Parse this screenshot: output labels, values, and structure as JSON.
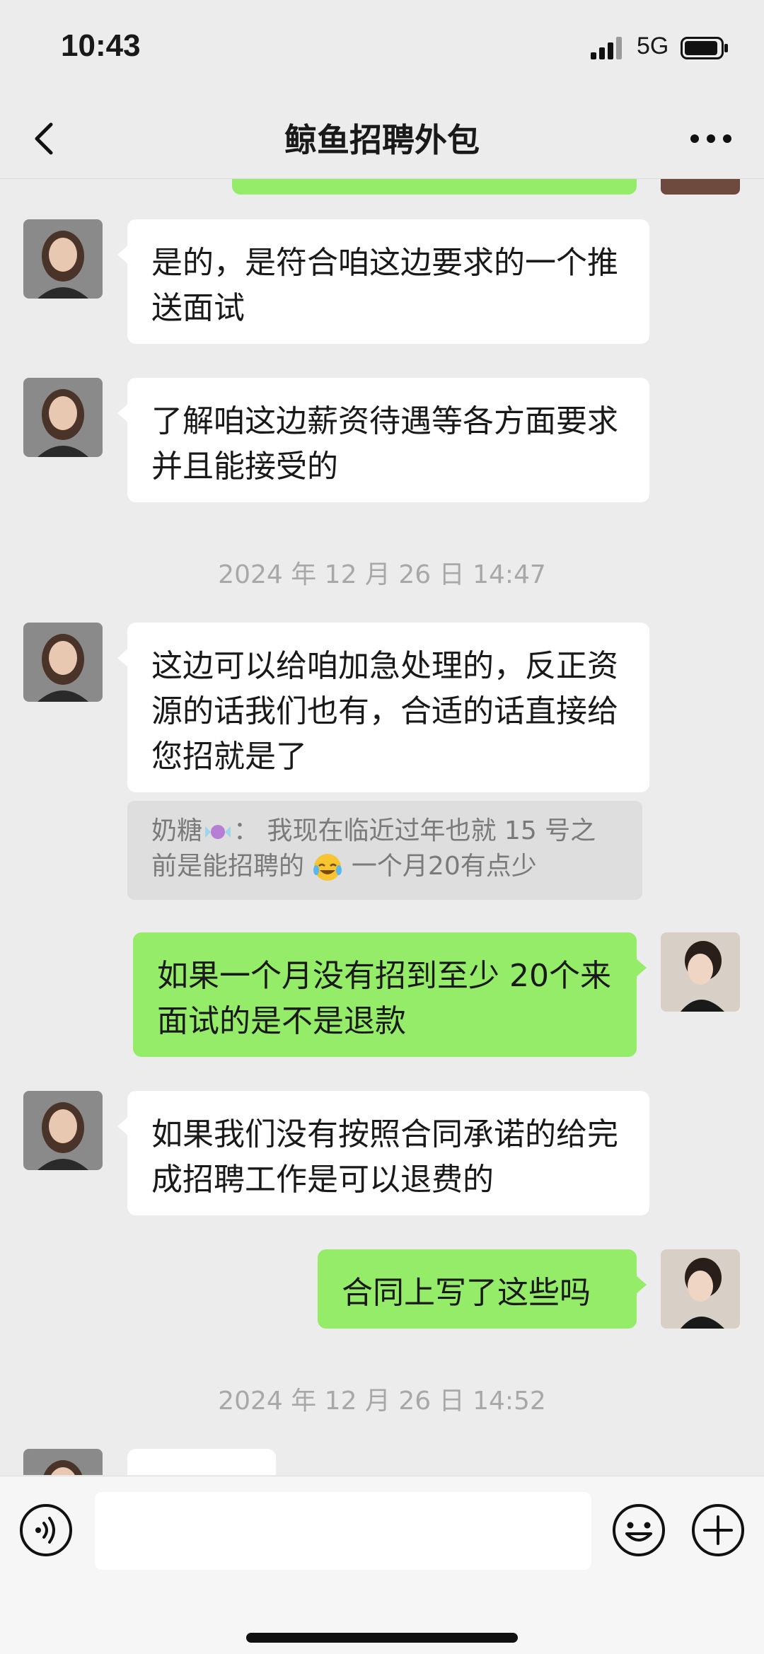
{
  "status": {
    "time": "10:43",
    "network": "5G"
  },
  "header": {
    "title": "鲸鱼招聘外包"
  },
  "messages": [
    {
      "side": "in",
      "text": "是的，是符合咱这边要求的一个推送面试"
    },
    {
      "side": "in",
      "text": "了解咱这边薪资待遇等各方面要求并且能接受的"
    },
    {
      "timestamp": "2024 年 12 月 26 日 14:47"
    },
    {
      "side": "in",
      "text": "这边可以给咱加急处理的，反正资源的话我们也有，合适的话直接给您招就是了"
    },
    {
      "quote": {
        "sender": "奶糖",
        "separator": "：",
        "text_before": "我现在临近过年也就 15 号之前是能招聘的",
        "text_after": "一个月20有点少"
      }
    },
    {
      "side": "out",
      "text": "如果一个月没有招到至少 20个来面试的是不是退款"
    },
    {
      "side": "in",
      "text": "如果我们没有按照合同承诺的给完成招聘工作是可以退费的"
    },
    {
      "side": "out",
      "text": "合同上写了这些吗"
    },
    {
      "timestamp": "2024 年 12 月 26 日 14:52"
    }
  ],
  "colors": {
    "out_bubble": "#95ec69",
    "in_bubble": "#ffffff",
    "background": "#ececec"
  },
  "icons": [
    "back-arrow-icon",
    "more-dots-icon",
    "voice-icon",
    "emoji-icon",
    "plus-icon",
    "candy-emoji",
    "laugh-cry-emoji"
  ]
}
